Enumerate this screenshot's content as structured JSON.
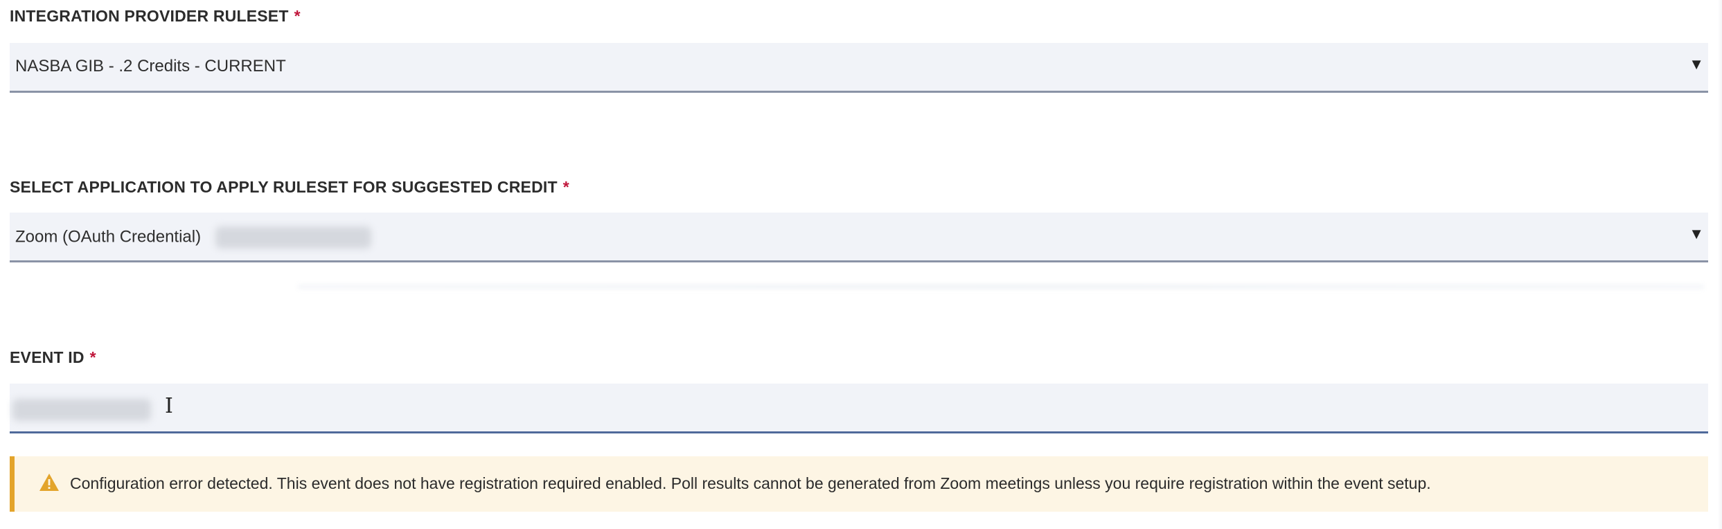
{
  "ruleset_field": {
    "label": "INTEGRATION PROVIDER RULESET",
    "required_marker": "*",
    "selected_value": "NASBA GIB - .2 Credits - CURRENT",
    "caret": "▼"
  },
  "application_field": {
    "label": "SELECT APPLICATION TO APPLY RULESET FOR SUGGESTED CREDIT",
    "required_marker": "*",
    "selected_value": "Zoom (OAuth Credential)",
    "caret": "▼"
  },
  "event_id_field": {
    "label": "EVENT ID",
    "required_marker": "*",
    "cursor_glyph": "I"
  },
  "alert": {
    "icon": "warning-triangle-icon",
    "message": "Configuration error detected. This event does not have registration required enabled. Poll results cannot be generated from Zoom meetings unless you require registration within the event setup.",
    "accent_color": "#e3a42b",
    "background_color": "#fdf5e4"
  },
  "colors": {
    "required": "#c0163b",
    "field_background": "#f1f3f8",
    "active_underline": "#4f6a9a"
  }
}
